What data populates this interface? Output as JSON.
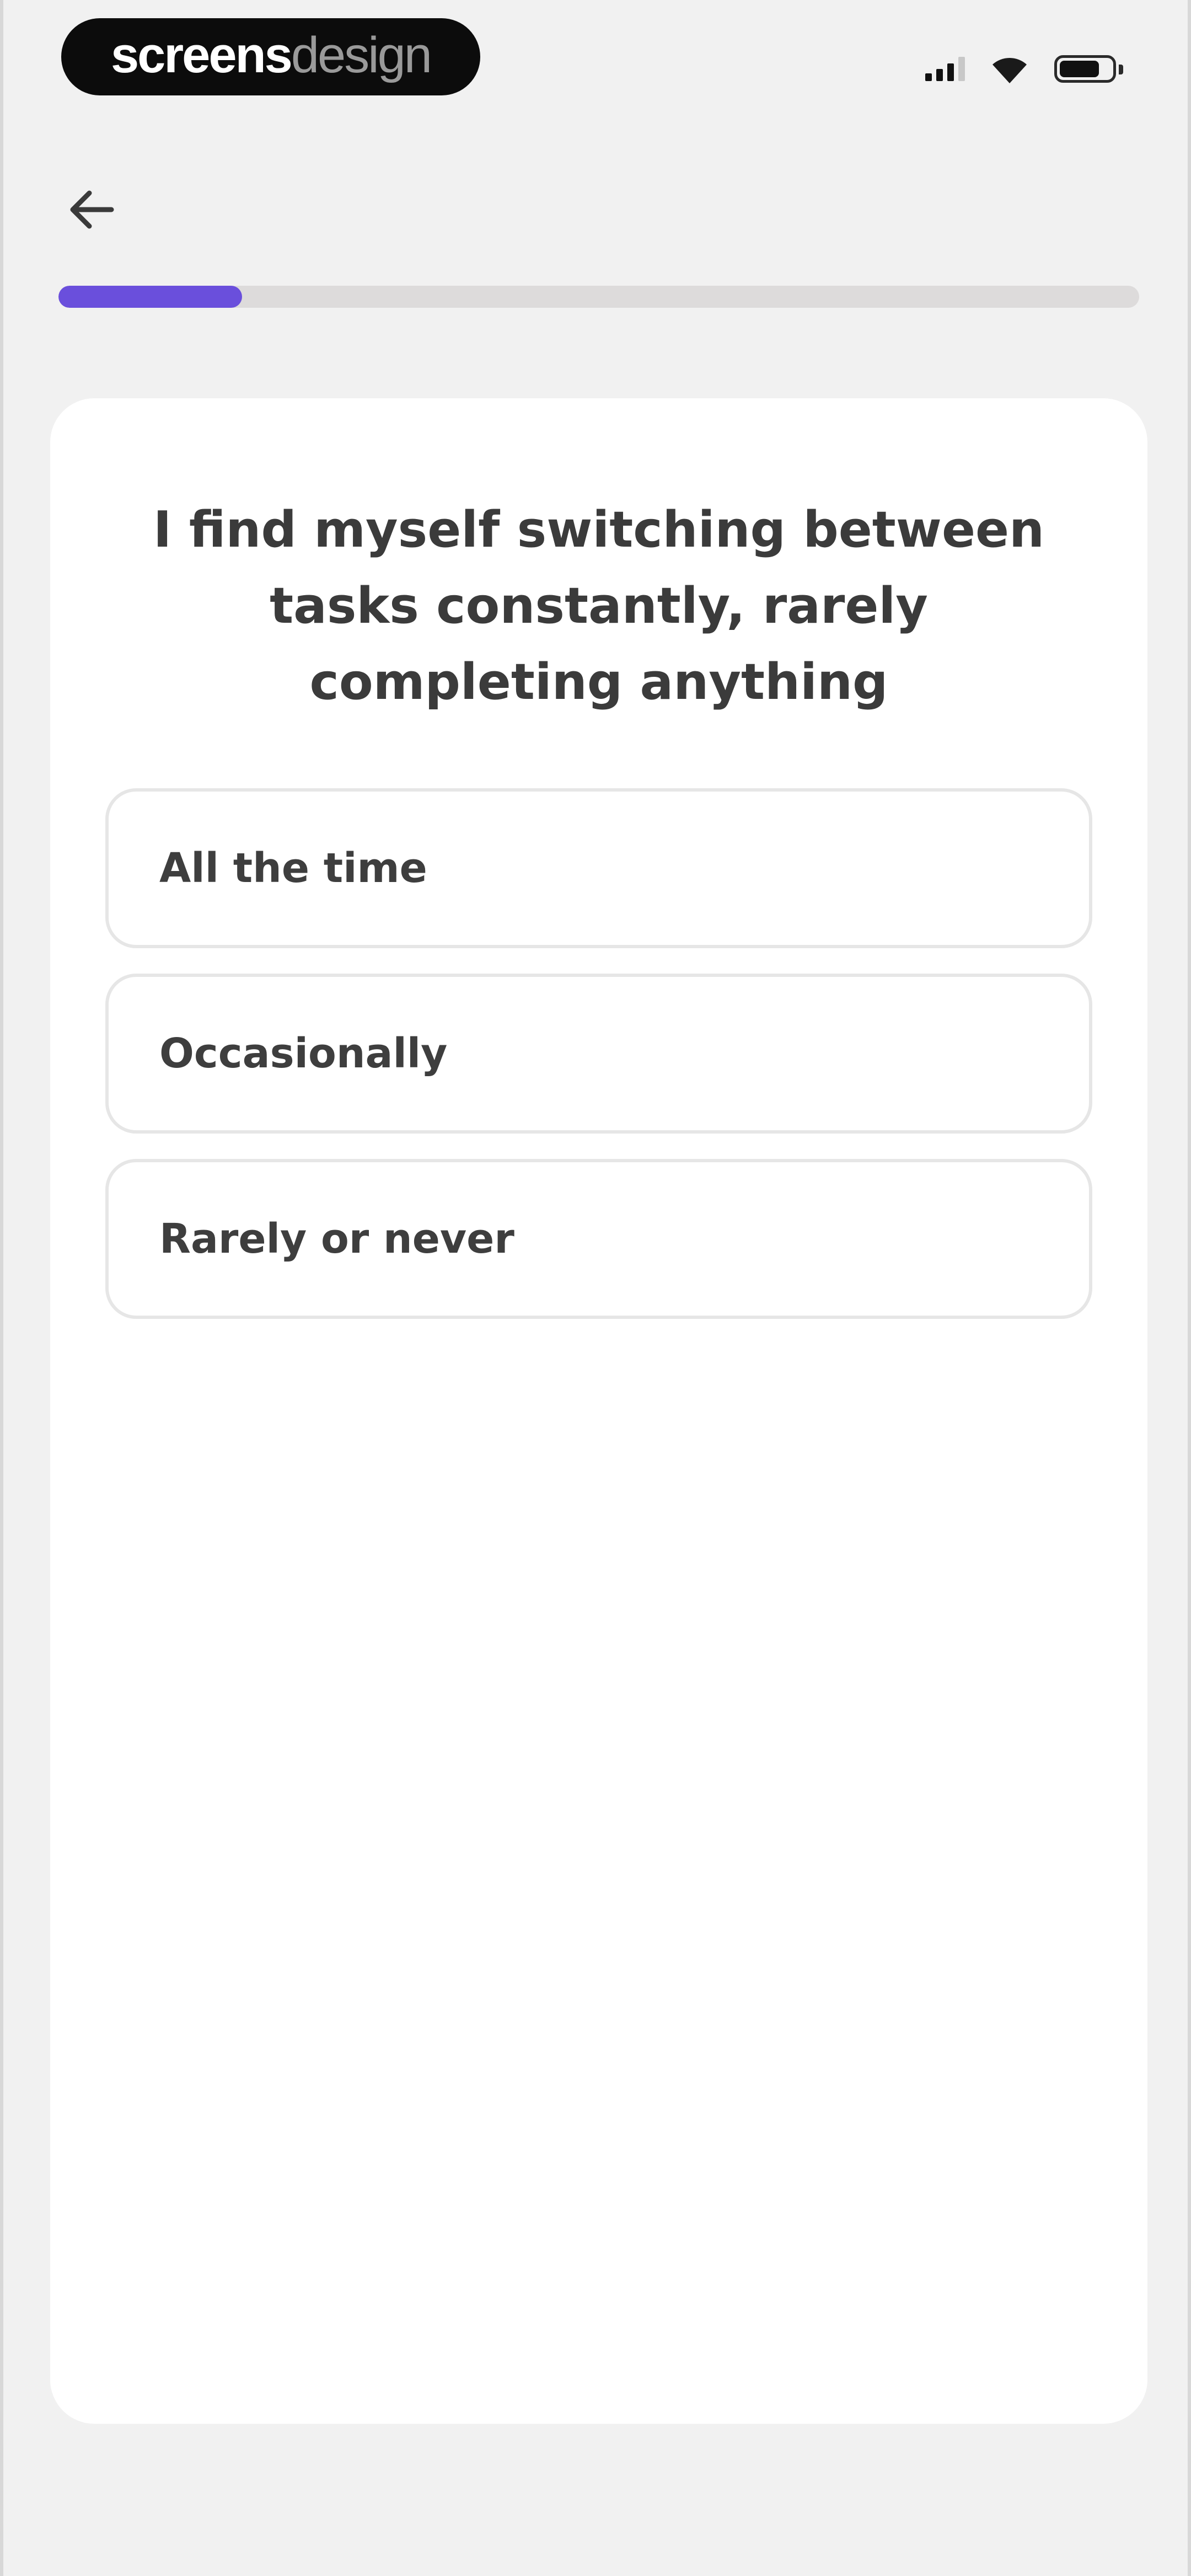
{
  "status_bar": {
    "brand_bold": "screens",
    "brand_light": "design",
    "icons": [
      "signal-icon",
      "wifi-icon",
      "battery-icon"
    ]
  },
  "nav": {
    "back_icon": "arrow-left-icon"
  },
  "progress": {
    "fraction": 0.17,
    "color": "#6a4fdc",
    "track_color": "#dddbdb"
  },
  "question": {
    "text": "I find myself switching between tasks constantly, rarely completing anything"
  },
  "options": [
    {
      "label": "All the time"
    },
    {
      "label": "Occasionally"
    },
    {
      "label": "Rarely or never"
    }
  ]
}
